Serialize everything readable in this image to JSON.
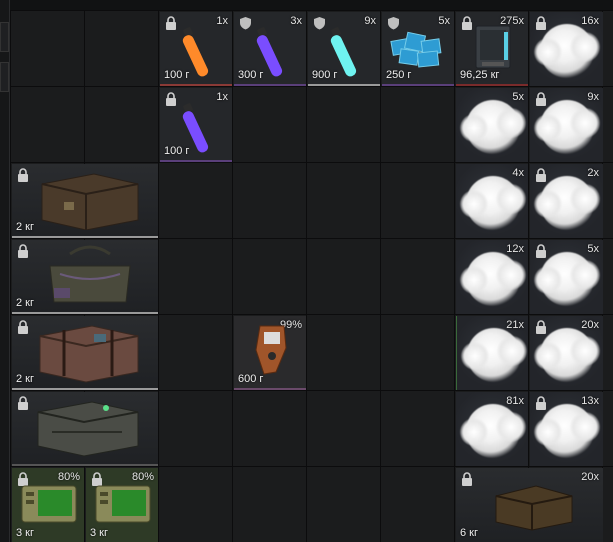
{
  "row1": {
    "orange_stick": {
      "qty": "1x",
      "weight": "100 г"
    },
    "purple_stick": {
      "qty": "3x",
      "weight": "300 г"
    },
    "cyan_stick": {
      "qty": "9x",
      "weight": "900 г"
    },
    "ice_crystals": {
      "qty": "5x",
      "weight": "250 г"
    },
    "equipment_case": {
      "qty": "275x",
      "weight": "96,25 кг"
    },
    "smoke_a": {
      "qty": "16x"
    }
  },
  "row2": {
    "purple_stick_2": {
      "qty": "1x",
      "weight": "100 г"
    },
    "smoke_b": {
      "qty": "5x"
    },
    "smoke_c": {
      "qty": "9x"
    }
  },
  "row3": {
    "box1": {
      "weight": "2 кг"
    },
    "smoke_d": {
      "qty": "4x"
    },
    "smoke_e": {
      "qty": "2x"
    }
  },
  "row4": {
    "bag": {
      "weight": "2 кг"
    },
    "smoke_f": {
      "qty": "12x"
    },
    "smoke_g": {
      "qty": "5x"
    }
  },
  "row5": {
    "box2": {
      "weight": "2 кг"
    },
    "scanner": {
      "qty": "99%",
      "weight": "600 г"
    },
    "smoke_h": {
      "qty": "21x"
    },
    "smoke_i": {
      "qty": "20x"
    }
  },
  "row6": {
    "box3": {
      "weight": "2 кг"
    },
    "smoke_j": {
      "qty": "81x"
    },
    "smoke_k": {
      "qty": "13x"
    }
  },
  "row7": {
    "device1": {
      "qty": "80%",
      "weight": "3 кг"
    },
    "device2": {
      "qty": "80%",
      "weight": "3 кг"
    },
    "crate": {
      "qty": "20x",
      "weight": "6 кг"
    }
  },
  "colors": {
    "bg": "#111213",
    "cell": "#25272a",
    "orange": "#ff8a2a",
    "purple": "#7a4dff",
    "cyan": "#6ff3f0"
  }
}
